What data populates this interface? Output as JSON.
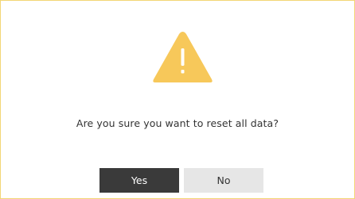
{
  "dialog": {
    "icon": "warning-triangle-icon",
    "message": "Are you sure you want to reset all data?",
    "yes_label": "Yes",
    "no_label": "No"
  },
  "colors": {
    "border": "#f2d675",
    "warning_icon": "#f7c85a",
    "yes_background": "#3a3a3a",
    "no_background": "#e6e6e6"
  }
}
